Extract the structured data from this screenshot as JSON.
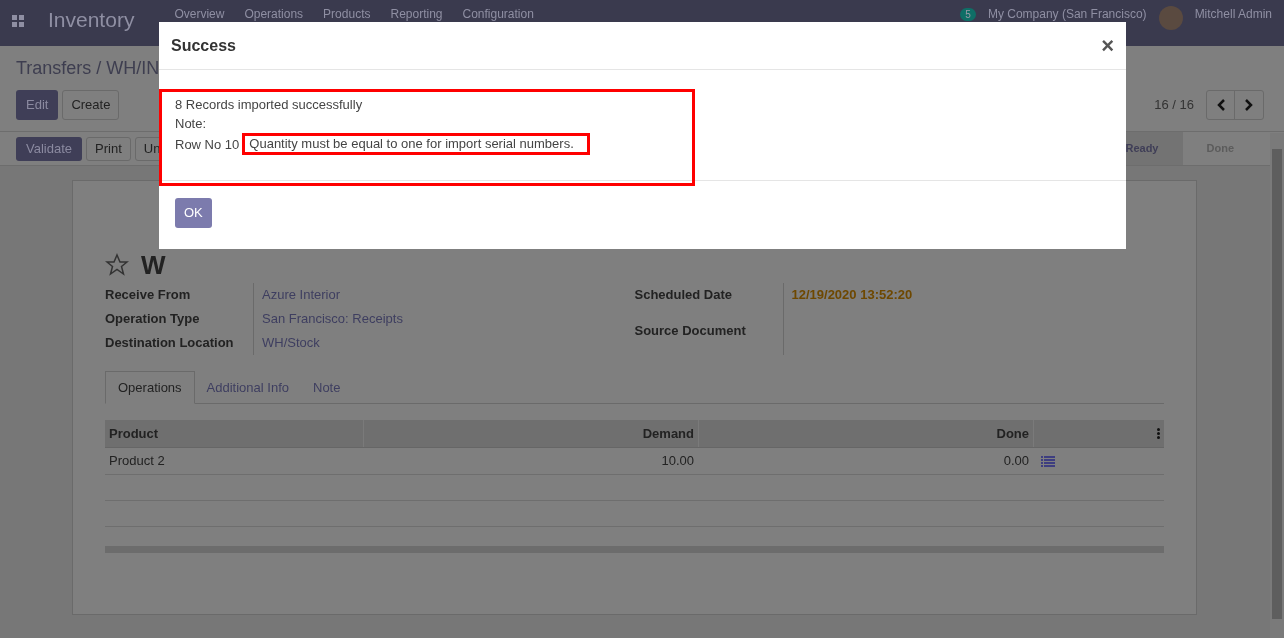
{
  "navbar": {
    "app_title": "Inventory",
    "menu": [
      "Overview",
      "Operations",
      "Products",
      "Reporting",
      "Configuration"
    ],
    "message_count": "5",
    "company": "My Company (San Francisco)",
    "user": "Mitchell Admin"
  },
  "breadcrumb": "Transfers / WH/IN",
  "buttons": {
    "edit": "Edit",
    "create": "Create"
  },
  "pager": "16 / 16",
  "actions": [
    {
      "label": "Validate",
      "kind": "primary"
    },
    {
      "label": "Print",
      "kind": "secondary"
    },
    {
      "label": "Un",
      "kind": "secondary"
    }
  ],
  "status_steps": [
    {
      "label": "Ready",
      "selected": true
    },
    {
      "label": "Done",
      "selected": false
    }
  ],
  "record": {
    "title": "W",
    "starred": false,
    "fields_left": [
      {
        "label": "Receive From",
        "value": "Azure Interior",
        "highlight": false
      },
      {
        "label": "Operation Type",
        "value": "San Francisco: Receipts",
        "highlight": false
      },
      {
        "label": "Destination Location",
        "value": "WH/Stock",
        "highlight": false
      }
    ],
    "fields_right": [
      {
        "label": "Scheduled Date",
        "value": "12/19/2020 13:52:20",
        "highlight": true
      },
      {
        "label": "Source Document"
      }
    ]
  },
  "tabs": [
    {
      "label": "Operations",
      "selected": true
    },
    {
      "label": "Additional Info",
      "selected": false
    },
    {
      "label": "Note",
      "selected": false
    }
  ],
  "table": {
    "columns": [
      "Product",
      "Demand",
      "Done"
    ],
    "rows": [
      {
        "cells": [
          "Product 2",
          "10.00",
          "0.00"
        ]
      }
    ]
  },
  "dialog": {
    "title": "Success",
    "close": "×",
    "lines": [
      "8 Records imported successfully",
      "Note:"
    ],
    "row_label": "Row No 10",
    "message": "Quantity must be equal to one for import serial numbers.",
    "button": "OK"
  }
}
